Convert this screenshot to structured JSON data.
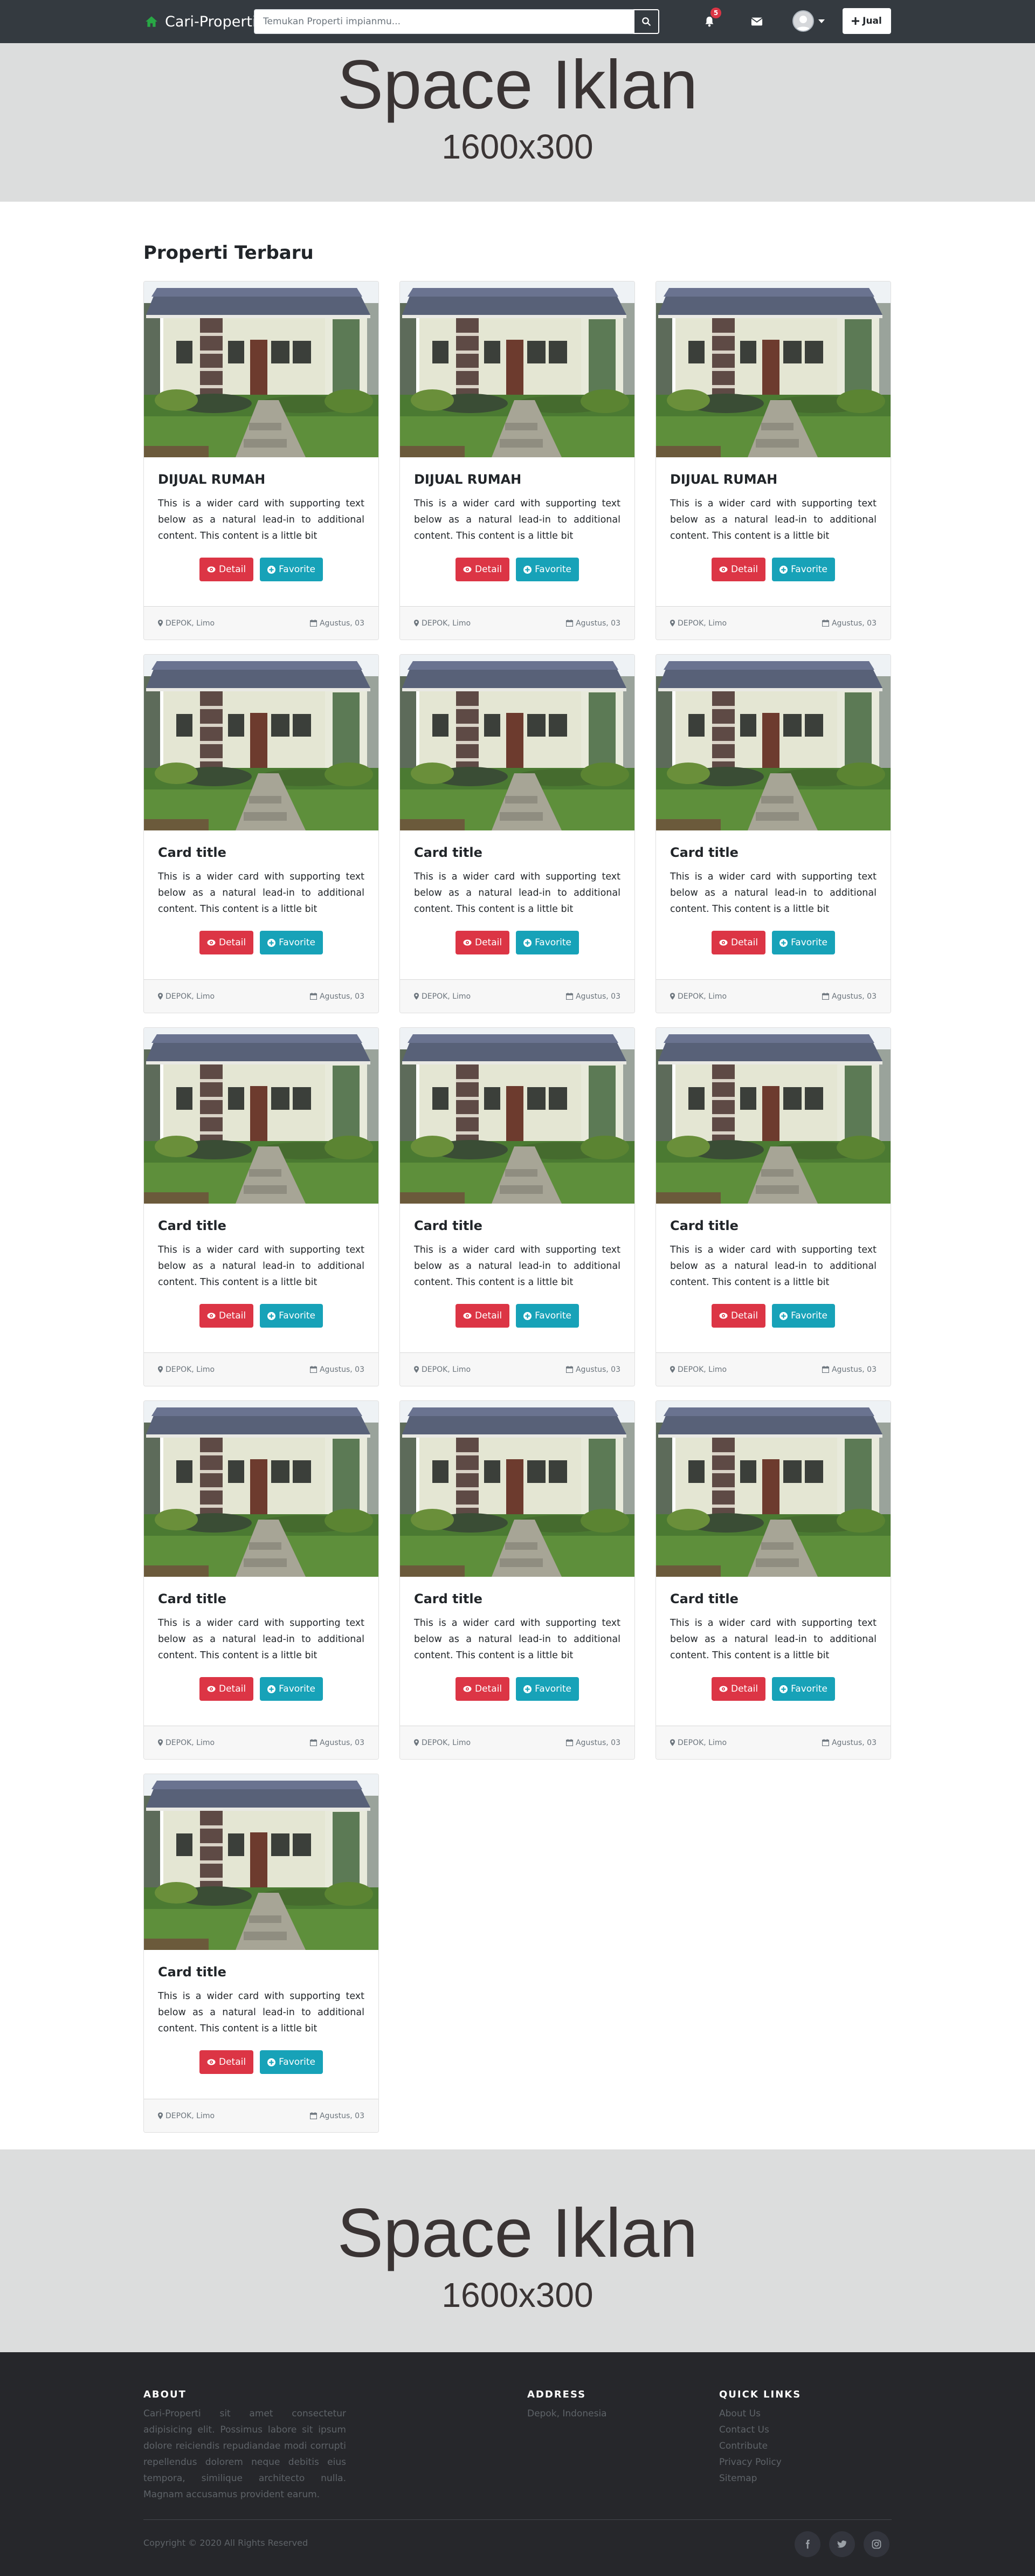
{
  "navbar": {
    "brand": "Cari-Properti",
    "search_placeholder": "Temukan Properti impianmu...",
    "notification_count": "5",
    "sell_label": "Jual"
  },
  "ads": {
    "top": {
      "title": "Space Iklan",
      "size": "1600x300"
    },
    "bottom": {
      "title": "Space Iklan",
      "size": "1600x300"
    }
  },
  "section": {
    "title": "Properti Terbaru"
  },
  "cards": [
    {
      "title": "DIJUAL RUMAH",
      "text": "This is a wider card with supporting text below as a natural lead-in to additional content. This content is a little bit",
      "detail": "Detail",
      "favorite": "Favorite",
      "location": "DEPOK, Limo",
      "date": "Agustus, 03"
    },
    {
      "title": "DIJUAL RUMAH",
      "text": "This is a wider card with supporting text below as a natural lead-in to additional content. This content is a little bit",
      "detail": "Detail",
      "favorite": "Favorite",
      "location": "DEPOK, Limo",
      "date": "Agustus, 03"
    },
    {
      "title": "DIJUAL RUMAH",
      "text": "This is a wider card with supporting text below as a natural lead-in to additional content. This content is a little bit",
      "detail": "Detail",
      "favorite": "Favorite",
      "location": "DEPOK, Limo",
      "date": "Agustus, 03"
    },
    {
      "title": "Card title",
      "text": "This is a wider card with supporting text below as a natural lead-in to additional content. This content is a little bit",
      "detail": "Detail",
      "favorite": "Favorite",
      "location": "DEPOK, Limo",
      "date": "Agustus, 03"
    },
    {
      "title": "Card title",
      "text": "This is a wider card with supporting text below as a natural lead-in to additional content. This content is a little bit",
      "detail": "Detail",
      "favorite": "Favorite",
      "location": "DEPOK, Limo",
      "date": "Agustus, 03"
    },
    {
      "title": "Card title",
      "text": "This is a wider card with supporting text below as a natural lead-in to additional content. This content is a little bit",
      "detail": "Detail",
      "favorite": "Favorite",
      "location": "DEPOK, Limo",
      "date": "Agustus, 03"
    },
    {
      "title": "Card title",
      "text": "This is a wider card with supporting text below as a natural lead-in to additional content. This content is a little bit",
      "detail": "Detail",
      "favorite": "Favorite",
      "location": "DEPOK, Limo",
      "date": "Agustus, 03"
    },
    {
      "title": "Card title",
      "text": "This is a wider card with supporting text below as a natural lead-in to additional content. This content is a little bit",
      "detail": "Detail",
      "favorite": "Favorite",
      "location": "DEPOK, Limo",
      "date": "Agustus, 03"
    },
    {
      "title": "Card title",
      "text": "This is a wider card with supporting text below as a natural lead-in to additional content. This content is a little bit",
      "detail": "Detail",
      "favorite": "Favorite",
      "location": "DEPOK, Limo",
      "date": "Agustus, 03"
    },
    {
      "title": "Card title",
      "text": "This is a wider card with supporting text below as a natural lead-in to additional content. This content is a little bit",
      "detail": "Detail",
      "favorite": "Favorite",
      "location": "DEPOK, Limo",
      "date": "Agustus, 03"
    },
    {
      "title": "Card title",
      "text": "This is a wider card with supporting text below as a natural lead-in to additional content. This content is a little bit",
      "detail": "Detail",
      "favorite": "Favorite",
      "location": "DEPOK, Limo",
      "date": "Agustus, 03"
    },
    {
      "title": "Card title",
      "text": "This is a wider card with supporting text below as a natural lead-in to additional content. This content is a little bit",
      "detail": "Detail",
      "favorite": "Favorite",
      "location": "DEPOK, Limo",
      "date": "Agustus, 03"
    },
    {
      "title": "Card title",
      "text": "This is a wider card with supporting text below as a natural lead-in to additional content. This content is a little bit",
      "detail": "Detail",
      "favorite": "Favorite",
      "location": "DEPOK, Limo",
      "date": "Agustus, 03"
    }
  ],
  "footer": {
    "about_heading": "ABOUT",
    "about_text": "Cari-Properti sit amet consectetur adipisicing elit. Possimus labore sit ipsum dolore reiciendis repudiandae modi corrupti repellendus dolorem neque debitis eius tempora, similique architecto nulla. Magnam accusamus provident earum.",
    "address_heading": "ADDRESS",
    "address_text": "Depok, Indonesia",
    "links_heading": "QUICK LINKS",
    "links": [
      "About Us",
      "Contact Us",
      "Contribute",
      "Privacy Policy",
      "Sitemap"
    ],
    "copyright": "Copyright © 2020 All Rights Reserved"
  },
  "icons": {
    "brand": "home-icon",
    "search": "search-icon",
    "notifications": "bell-icon",
    "messages": "envelope-icon",
    "sell": "plus-icon",
    "detail": "eye-icon",
    "favorite": "plus-circle-icon",
    "location": "map-marker-icon",
    "date": "calendar-icon",
    "socials": [
      "facebook-icon",
      "twitter-icon",
      "instagram-icon"
    ]
  },
  "colors": {
    "navbar": "#343a40",
    "brand_icon": "#28a745",
    "danger": "#dc3545",
    "info": "#17a2b8",
    "ad_background": "#dcdddd",
    "footer": "#26272b"
  }
}
